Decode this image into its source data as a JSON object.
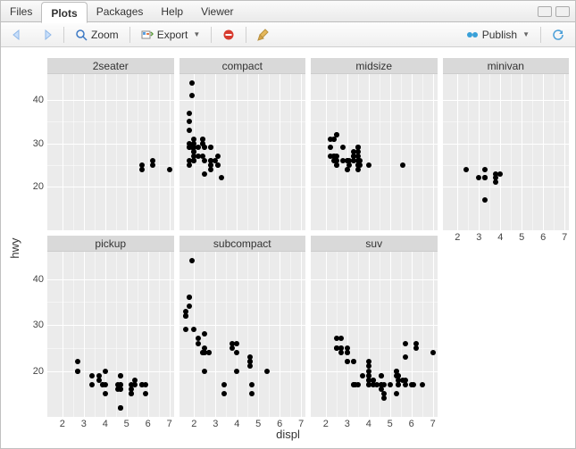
{
  "tabs": [
    "Files",
    "Plots",
    "Packages",
    "Help",
    "Viewer"
  ],
  "toolbar": {
    "zoom": "Zoom",
    "export": "Export",
    "publish": "Publish"
  },
  "chart_data": {
    "type": "scatter",
    "xlabel": "displ",
    "ylabel": "hwy",
    "xlim": [
      1.3,
      7.2
    ],
    "ylim": [
      10,
      46
    ],
    "x_ticks": [
      2,
      3,
      4,
      5,
      6,
      7
    ],
    "y_ticks": [
      20,
      30,
      40
    ],
    "facets": [
      {
        "label": "2seater",
        "row": 0,
        "col": 0,
        "points": [
          {
            "x": 5.7,
            "y": 25
          },
          {
            "x": 5.7,
            "y": 24
          },
          {
            "x": 6.2,
            "y": 26
          },
          {
            "x": 6.2,
            "y": 25
          },
          {
            "x": 7.0,
            "y": 24
          }
        ]
      },
      {
        "label": "compact",
        "row": 0,
        "col": 1,
        "points": [
          {
            "x": 1.8,
            "y": 29
          },
          {
            "x": 1.8,
            "y": 29
          },
          {
            "x": 2.0,
            "y": 31
          },
          {
            "x": 2.0,
            "y": 30
          },
          {
            "x": 2.8,
            "y": 26
          },
          {
            "x": 2.8,
            "y": 26
          },
          {
            "x": 3.1,
            "y": 27
          },
          {
            "x": 1.8,
            "y": 26
          },
          {
            "x": 1.8,
            "y": 25
          },
          {
            "x": 2.0,
            "y": 28
          },
          {
            "x": 2.0,
            "y": 27
          },
          {
            "x": 2.8,
            "y": 25
          },
          {
            "x": 2.8,
            "y": 25
          },
          {
            "x": 3.1,
            "y": 25
          },
          {
            "x": 3.1,
            "y": 25
          },
          {
            "x": 2.4,
            "y": 30
          },
          {
            "x": 2.4,
            "y": 30
          },
          {
            "x": 2.5,
            "y": 26
          },
          {
            "x": 2.5,
            "y": 23
          },
          {
            "x": 2.2,
            "y": 27
          },
          {
            "x": 2.2,
            "y": 29
          },
          {
            "x": 2.4,
            "y": 31
          },
          {
            "x": 2.4,
            "y": 31
          },
          {
            "x": 3.0,
            "y": 26
          },
          {
            "x": 1.8,
            "y": 30
          },
          {
            "x": 1.8,
            "y": 33
          },
          {
            "x": 1.8,
            "y": 35
          },
          {
            "x": 1.8,
            "y": 37
          },
          {
            "x": 2.0,
            "y": 26
          },
          {
            "x": 2.0,
            "y": 29
          },
          {
            "x": 2.0,
            "y": 29
          },
          {
            "x": 2.0,
            "y": 29
          },
          {
            "x": 2.0,
            "y": 29
          },
          {
            "x": 2.8,
            "y": 24
          },
          {
            "x": 1.9,
            "y": 44
          },
          {
            "x": 2.0,
            "y": 29
          },
          {
            "x": 2.0,
            "y": 26
          },
          {
            "x": 2.5,
            "y": 29
          },
          {
            "x": 2.5,
            "y": 29
          },
          {
            "x": 2.8,
            "y": 29
          },
          {
            "x": 2.8,
            "y": 29
          },
          {
            "x": 1.9,
            "y": 41
          },
          {
            "x": 1.9,
            "y": 29
          },
          {
            "x": 2.0,
            "y": 26
          },
          {
            "x": 2.0,
            "y": 28
          },
          {
            "x": 3.3,
            "y": 22
          },
          {
            "x": 2.4,
            "y": 27
          }
        ]
      },
      {
        "label": "midsize",
        "row": 0,
        "col": 2,
        "points": [
          {
            "x": 2.4,
            "y": 27
          },
          {
            "x": 3.1,
            "y": 25
          },
          {
            "x": 3.5,
            "y": 25
          },
          {
            "x": 3.6,
            "y": 25
          },
          {
            "x": 2.4,
            "y": 27
          },
          {
            "x": 2.4,
            "y": 27
          },
          {
            "x": 3.5,
            "y": 29
          },
          {
            "x": 2.4,
            "y": 26
          },
          {
            "x": 2.4,
            "y": 27
          },
          {
            "x": 3.3,
            "y": 28
          },
          {
            "x": 2.5,
            "y": 27
          },
          {
            "x": 2.5,
            "y": 25
          },
          {
            "x": 3.5,
            "y": 27
          },
          {
            "x": 3.0,
            "y": 26
          },
          {
            "x": 3.0,
            "y": 26
          },
          {
            "x": 3.5,
            "y": 26
          },
          {
            "x": 3.3,
            "y": 27
          },
          {
            "x": 3.3,
            "y": 26
          },
          {
            "x": 4.0,
            "y": 25
          },
          {
            "x": 5.6,
            "y": 25
          },
          {
            "x": 2.5,
            "y": 32
          },
          {
            "x": 2.5,
            "y": 32
          },
          {
            "x": 3.3,
            "y": 27
          },
          {
            "x": 2.5,
            "y": 26
          },
          {
            "x": 2.5,
            "y": 25
          },
          {
            "x": 3.5,
            "y": 25
          },
          {
            "x": 3.5,
            "y": 24
          },
          {
            "x": 3.0,
            "y": 24
          },
          {
            "x": 3.0,
            "y": 24
          },
          {
            "x": 3.5,
            "y": 29
          },
          {
            "x": 3.5,
            "y": 28
          },
          {
            "x": 3.5,
            "y": 29
          },
          {
            "x": 2.8,
            "y": 26
          },
          {
            "x": 2.8,
            "y": 29
          },
          {
            "x": 3.6,
            "y": 26
          },
          {
            "x": 2.4,
            "y": 31
          },
          {
            "x": 2.4,
            "y": 31
          },
          {
            "x": 3.1,
            "y": 26
          },
          {
            "x": 2.2,
            "y": 29
          },
          {
            "x": 2.2,
            "y": 27
          },
          {
            "x": 2.2,
            "y": 31
          }
        ]
      },
      {
        "label": "minivan",
        "row": 0,
        "col": 3,
        "points": [
          {
            "x": 2.4,
            "y": 24
          },
          {
            "x": 3.0,
            "y": 22
          },
          {
            "x": 3.3,
            "y": 22
          },
          {
            "x": 3.3,
            "y": 22
          },
          {
            "x": 3.3,
            "y": 17
          },
          {
            "x": 3.3,
            "y": 22
          },
          {
            "x": 3.3,
            "y": 24
          },
          {
            "x": 3.8,
            "y": 22
          },
          {
            "x": 3.8,
            "y": 21
          },
          {
            "x": 3.8,
            "y": 23
          },
          {
            "x": 4.0,
            "y": 23
          }
        ]
      },
      {
        "label": "pickup",
        "row": 1,
        "col": 0,
        "points": [
          {
            "x": 3.7,
            "y": 19
          },
          {
            "x": 3.7,
            "y": 18
          },
          {
            "x": 3.9,
            "y": 17
          },
          {
            "x": 3.9,
            "y": 17
          },
          {
            "x": 4.7,
            "y": 19
          },
          {
            "x": 4.7,
            "y": 19
          },
          {
            "x": 4.7,
            "y": 12
          },
          {
            "x": 5.2,
            "y": 17
          },
          {
            "x": 5.2,
            "y": 15
          },
          {
            "x": 5.7,
            "y": 17
          },
          {
            "x": 5.9,
            "y": 17
          },
          {
            "x": 4.7,
            "y": 16
          },
          {
            "x": 4.7,
            "y": 12
          },
          {
            "x": 4.7,
            "y": 17
          },
          {
            "x": 4.7,
            "y": 17
          },
          {
            "x": 4.7,
            "y": 16
          },
          {
            "x": 4.7,
            "y": 12
          },
          {
            "x": 5.2,
            "y": 15
          },
          {
            "x": 5.2,
            "y": 16
          },
          {
            "x": 5.7,
            "y": 17
          },
          {
            "x": 5.9,
            "y": 15
          },
          {
            "x": 4.6,
            "y": 16
          },
          {
            "x": 5.4,
            "y": 18
          },
          {
            "x": 5.4,
            "y": 17
          },
          {
            "x": 2.7,
            "y": 20
          },
          {
            "x": 2.7,
            "y": 20
          },
          {
            "x": 2.7,
            "y": 22
          },
          {
            "x": 3.4,
            "y": 17
          },
          {
            "x": 3.4,
            "y": 19
          },
          {
            "x": 4.0,
            "y": 20
          },
          {
            "x": 4.0,
            "y": 15
          },
          {
            "x": 4.0,
            "y": 17
          },
          {
            "x": 4.6,
            "y": 17
          }
        ]
      },
      {
        "label": "subcompact",
        "row": 1,
        "col": 1,
        "points": [
          {
            "x": 3.8,
            "y": 26
          },
          {
            "x": 3.8,
            "y": 25
          },
          {
            "x": 4.0,
            "y": 26
          },
          {
            "x": 4.0,
            "y": 24
          },
          {
            "x": 4.6,
            "y": 21
          },
          {
            "x": 4.6,
            "y": 22
          },
          {
            "x": 4.6,
            "y": 23
          },
          {
            "x": 4.6,
            "y": 22
          },
          {
            "x": 5.4,
            "y": 20
          },
          {
            "x": 1.6,
            "y": 33
          },
          {
            "x": 1.6,
            "y": 32
          },
          {
            "x": 1.6,
            "y": 32
          },
          {
            "x": 1.6,
            "y": 29
          },
          {
            "x": 1.6,
            "y": 32
          },
          {
            "x": 1.8,
            "y": 34
          },
          {
            "x": 1.8,
            "y": 36
          },
          {
            "x": 1.8,
            "y": 36
          },
          {
            "x": 2.0,
            "y": 29
          },
          {
            "x": 2.4,
            "y": 24
          },
          {
            "x": 2.4,
            "y": 24
          },
          {
            "x": 2.5,
            "y": 24
          },
          {
            "x": 2.5,
            "y": 24
          },
          {
            "x": 2.5,
            "y": 20
          },
          {
            "x": 2.7,
            "y": 24
          },
          {
            "x": 2.7,
            "y": 24
          },
          {
            "x": 3.4,
            "y": 15
          },
          {
            "x": 3.4,
            "y": 17
          },
          {
            "x": 4.0,
            "y": 20
          },
          {
            "x": 4.7,
            "y": 17
          },
          {
            "x": 4.7,
            "y": 15
          },
          {
            "x": 2.2,
            "y": 26
          },
          {
            "x": 2.2,
            "y": 27
          },
          {
            "x": 2.5,
            "y": 28
          },
          {
            "x": 2.5,
            "y": 25
          },
          {
            "x": 1.9,
            "y": 44
          }
        ]
      },
      {
        "label": "suv",
        "row": 1,
        "col": 2,
        "points": [
          {
            "x": 5.3,
            "y": 20
          },
          {
            "x": 5.3,
            "y": 15
          },
          {
            "x": 5.3,
            "y": 20
          },
          {
            "x": 5.7,
            "y": 17
          },
          {
            "x": 6.0,
            "y": 17
          },
          {
            "x": 5.7,
            "y": 26
          },
          {
            "x": 5.7,
            "y": 23
          },
          {
            "x": 6.2,
            "y": 26
          },
          {
            "x": 6.2,
            "y": 25
          },
          {
            "x": 7.0,
            "y": 24
          },
          {
            "x": 6.5,
            "y": 17
          },
          {
            "x": 2.7,
            "y": 25
          },
          {
            "x": 2.7,
            "y": 24
          },
          {
            "x": 2.7,
            "y": 27
          },
          {
            "x": 3.0,
            "y": 25
          },
          {
            "x": 3.7,
            "y": 19
          },
          {
            "x": 4.0,
            "y": 18
          },
          {
            "x": 4.7,
            "y": 14
          },
          {
            "x": 4.7,
            "y": 15
          },
          {
            "x": 4.7,
            "y": 17
          },
          {
            "x": 5.7,
            "y": 18
          },
          {
            "x": 6.1,
            "y": 17
          },
          {
            "x": 4.0,
            "y": 17
          },
          {
            "x": 4.2,
            "y": 17
          },
          {
            "x": 4.4,
            "y": 17
          },
          {
            "x": 4.6,
            "y": 16
          },
          {
            "x": 5.4,
            "y": 17
          },
          {
            "x": 5.4,
            "y": 17
          },
          {
            "x": 5.4,
            "y": 18
          },
          {
            "x": 4.0,
            "y": 17
          },
          {
            "x": 4.0,
            "y": 19
          },
          {
            "x": 4.0,
            "y": 18
          },
          {
            "x": 4.0,
            "y": 19
          },
          {
            "x": 4.6,
            "y": 19
          },
          {
            "x": 5.0,
            "y": 17
          },
          {
            "x": 4.2,
            "y": 18
          },
          {
            "x": 4.2,
            "y": 18
          },
          {
            "x": 4.6,
            "y": 17
          },
          {
            "x": 4.6,
            "y": 17
          },
          {
            "x": 4.6,
            "y": 19
          },
          {
            "x": 5.4,
            "y": 19
          },
          {
            "x": 5.4,
            "y": 19
          },
          {
            "x": 3.0,
            "y": 22
          },
          {
            "x": 3.0,
            "y": 22
          },
          {
            "x": 3.3,
            "y": 17
          },
          {
            "x": 3.3,
            "y": 17
          },
          {
            "x": 4.0,
            "y": 21
          },
          {
            "x": 5.6,
            "y": 18
          },
          {
            "x": 3.0,
            "y": 24
          },
          {
            "x": 3.0,
            "y": 24
          },
          {
            "x": 3.5,
            "y": 17
          },
          {
            "x": 3.3,
            "y": 22
          },
          {
            "x": 3.3,
            "y": 22
          },
          {
            "x": 4.0,
            "y": 22
          },
          {
            "x": 5.3,
            "y": 19
          },
          {
            "x": 2.5,
            "y": 25
          },
          {
            "x": 2.5,
            "y": 27
          },
          {
            "x": 2.5,
            "y": 25
          },
          {
            "x": 2.5,
            "y": 25
          },
          {
            "x": 2.7,
            "y": 25
          },
          {
            "x": 3.4,
            "y": 17
          },
          {
            "x": 4.0,
            "y": 20
          }
        ]
      }
    ]
  }
}
